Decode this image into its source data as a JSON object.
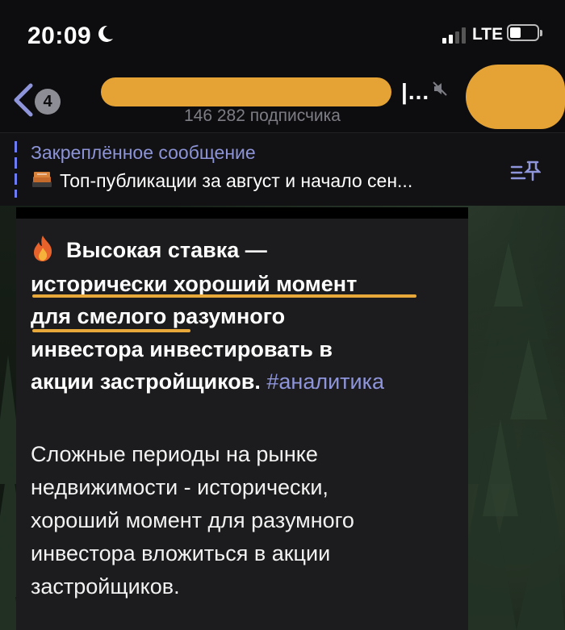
{
  "status_bar": {
    "time": "20:09",
    "network": "LTE",
    "signal_bars": 4,
    "signal_active": 2,
    "battery_level": 0.3
  },
  "header": {
    "unread_count": "4",
    "title_visible": "|...",
    "subscribers": "146 282 подписчика"
  },
  "pinned": {
    "label": "Закреплённое сообщение",
    "text": "Топ-публикации за август и начало сен..."
  },
  "message": {
    "headline_lines": [
      "Высокая ставка —",
      "исторически хороший момент",
      "для смелого разумного",
      "инвестора инвестировать в",
      "акции застройщиков."
    ],
    "hashtag": "#аналитика",
    "body_lines": [
      "Сложные периоды на рынке",
      "недвижимости - исторически,",
      "хороший момент для разумного",
      "инвестора вложиться в акции",
      "застройщиков."
    ]
  },
  "colors": {
    "accent": "#8e95da",
    "highlight": "#e9a83a",
    "bubble": "#1c1c1e",
    "bar": "#0d0d0f"
  }
}
